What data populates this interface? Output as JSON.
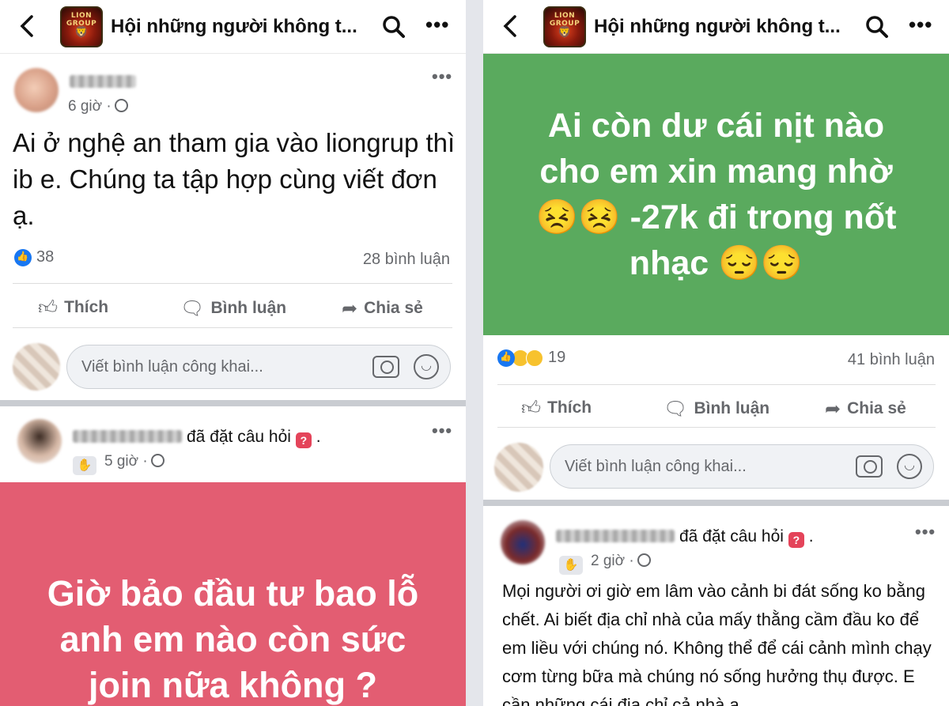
{
  "colors": {
    "green_bg": "#5aaa5e",
    "pink_bg": "#e35d72",
    "accent": "#1877f2"
  },
  "left": {
    "header": {
      "back_icon": "chevron-left-icon",
      "group_logo_top": "LION GROUP",
      "title": "Hội những người không t..."
    },
    "post1": {
      "time": "6 giờ ·",
      "text": "Ai ở nghệ an tham gia vào liongrup thì ib e. Chúng ta tập hợp cùng viết đơn ạ.",
      "reaction_count": "38",
      "comment_count": "28 bình luận",
      "actions": {
        "like": "Thích",
        "comment": "Bình luận",
        "share": "Chia sẻ"
      },
      "comment_placeholder": "Viết bình luận công khai..."
    },
    "post2": {
      "asked": "đã đặt câu hỏi",
      "question_badge": "?",
      "time": "5 giờ ·",
      "bg_text": "Giờ bảo đầu tư bao lỗ anh em nào còn sức join nữa không ?"
    }
  },
  "right": {
    "header": {
      "group_logo_top": "LION GROUP",
      "title": "Hội những người không t..."
    },
    "post1": {
      "bg_text": "Ai còn dư cái nịt nào cho em xin mang nhờ 😣😣 -27k đi trong nốt nhạc 😔😔",
      "reaction_count": "19",
      "comment_count": "41 bình luận",
      "actions": {
        "like": "Thích",
        "comment": "Bình luận",
        "share": "Chia sẻ"
      },
      "comment_placeholder": "Viết bình luận công khai..."
    },
    "post2": {
      "asked": "đã đặt câu hỏi",
      "question_badge": "?",
      "time": "2 giờ ·",
      "text": "Mọi người ơi giờ em lâm vào cảnh bi đát sống ko bằng chết. Ai biết địa chỉ nhà của mấy thằng cầm đầu ko để em liều với chúng nó. Không thể để cái cảnh mình chạy cơm từng bữa mà chúng nó sống hưởng thụ được. E cần những cái địa chỉ cả nhà ạ"
    }
  }
}
